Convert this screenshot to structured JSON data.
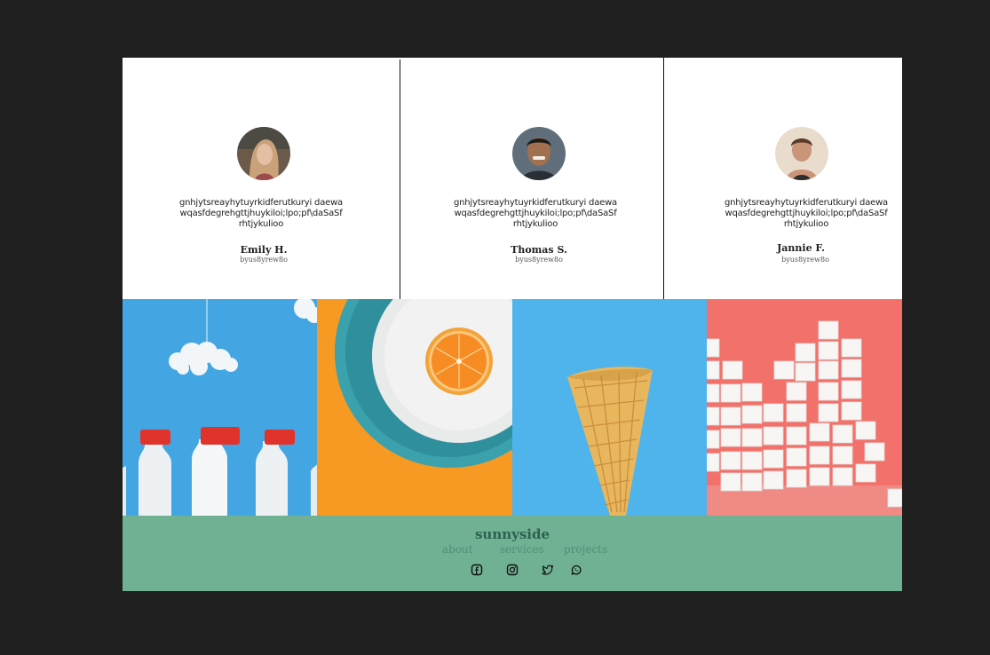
{
  "testimonials": [
    {
      "quote": "gnhjytsreayhytuyrkidferutkuryi daewawqasfdegrehgttjhuykiloi;lpo;pf\\daSaSfrhtjykulioo",
      "name": "Emily H.",
      "role": "byus8yrew8o"
    },
    {
      "quote": "gnhjytsreayhytuyrkidferutkuryi daewawqasfdegrehgttjhuykiloi;lpo;pf\\daSaSfrhtjykulioo",
      "name": "Thomas S.",
      "role": "byus8yrew8o"
    },
    {
      "quote": "gnhjytsreayhytuyrkidferutkuryi daewawqasfdegrehgttjhuykiloi;lpo;pf\\daSaSfrhtjykulioo",
      "name": "Jannie F.",
      "role": "byus8yrew8o"
    }
  ],
  "gallery": [
    {
      "name": "milk-bottles"
    },
    {
      "name": "orange-on-plate"
    },
    {
      "name": "ice-cream-cone"
    },
    {
      "name": "sugar-cubes"
    }
  ],
  "footer": {
    "brand": "sunnyside",
    "nav": {
      "about": "about",
      "services": "services",
      "projects": "projects"
    },
    "social_icons": [
      "facebook-icon",
      "instagram-icon",
      "twitter-icon",
      "whatsapp-icon"
    ]
  },
  "colors": {
    "background": "#1f1f1f",
    "footer": "#70b093",
    "brand_text": "#2c6150"
  }
}
